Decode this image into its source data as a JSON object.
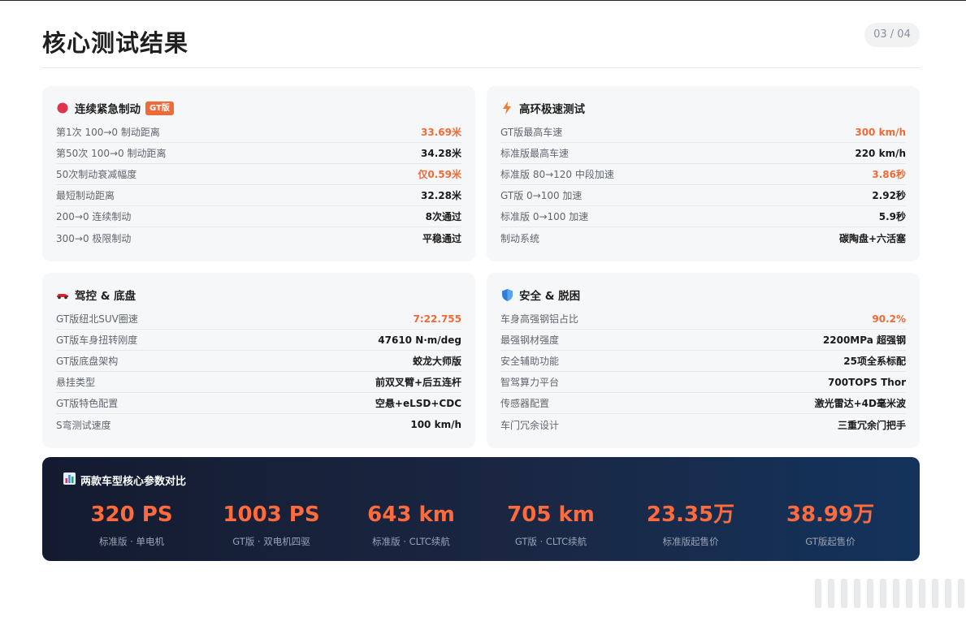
{
  "page": {
    "title": "核心测试结果",
    "counter": "03 / 04"
  },
  "cards": [
    {
      "title": "连续紧急制动",
      "tag": "GT版",
      "icon": "red-dot-icon",
      "rows": [
        {
          "label": "第1次 100→0 制动距离",
          "value": "33.69米",
          "highlight": true
        },
        {
          "label": "第50次 100→0 制动距离",
          "value": "34.28米",
          "highlight": false
        },
        {
          "label": "50次制动衰减幅度",
          "value": "仅0.59米",
          "highlight": true
        },
        {
          "label": "最短制动距离",
          "value": "32.28米",
          "highlight": false
        },
        {
          "label": "200→0 连续制动",
          "value": "8次通过",
          "highlight": false
        },
        {
          "label": "300→0 极限制动",
          "value": "平稳通过",
          "highlight": false
        }
      ]
    },
    {
      "title": "高环极速测试",
      "icon": "lightning-icon",
      "rows": [
        {
          "label": "GT版最高车速",
          "value": "300 km/h",
          "highlight": true
        },
        {
          "label": "标准版最高车速",
          "value": "220 km/h",
          "highlight": false
        },
        {
          "label": "标准版 80→120 中段加速",
          "value": "3.86秒",
          "highlight": true
        },
        {
          "label": "GT版 0→100 加速",
          "value": "2.92秒",
          "highlight": false
        },
        {
          "label": "标准版 0→100 加速",
          "value": "5.9秒",
          "highlight": false
        },
        {
          "label": "制动系统",
          "value": "碳陶盘+六活塞",
          "highlight": false
        }
      ]
    },
    {
      "title": "驾控 & 底盘",
      "icon": "race-car-icon",
      "rows": [
        {
          "label": "GT版纽北SUV圈速",
          "value": "7:22.755",
          "highlight": true
        },
        {
          "label": "GT版车身扭转刚度",
          "value": "47610 N·m/deg",
          "highlight": false
        },
        {
          "label": "GT版底盘架构",
          "value": "蛟龙大师版",
          "highlight": false
        },
        {
          "label": "悬挂类型",
          "value": "前双叉臂+后五连杆",
          "highlight": false
        },
        {
          "label": "GT版特色配置",
          "value": "空悬+eLSD+CDC",
          "highlight": false
        },
        {
          "label": "S弯测试速度",
          "value": "100 km/h",
          "highlight": false
        }
      ]
    },
    {
      "title": "安全 & 脱困",
      "icon": "shield-icon",
      "rows": [
        {
          "label": "车身高强钢铝占比",
          "value": "90.2%",
          "highlight": true
        },
        {
          "label": "最强钢材强度",
          "value": "2200MPa 超强钢",
          "highlight": false
        },
        {
          "label": "安全辅助功能",
          "value": "25项全系标配",
          "highlight": false
        },
        {
          "label": "智驾算力平台",
          "value": "700TOPS Thor",
          "highlight": false
        },
        {
          "label": "传感器配置",
          "value": "激光雷达+4D毫米波",
          "highlight": false
        },
        {
          "label": "车门冗余设计",
          "value": "三重冗余门把手",
          "highlight": false
        }
      ]
    }
  ],
  "comparison": {
    "title": "两款车型核心参数对比",
    "icon": "bar-chart-icon",
    "stats": [
      {
        "value": "320 PS",
        "label": "标准版 · 单电机"
      },
      {
        "value": "1003 PS",
        "label": "GT版 · 双电机四驱"
      },
      {
        "value": "643 km",
        "label": "标准版 · CLTC续航"
      },
      {
        "value": "705 km",
        "label": "GT版 · CLTC续航"
      },
      {
        "value": "23.35万",
        "label": "标准版起售价"
      },
      {
        "value": "38.99万",
        "label": "GT版起售价"
      }
    ]
  },
  "colors": {
    "accent": "#f06a35",
    "tag": "#ee6a3a",
    "card_bg": "#f6f7f9",
    "banner_start": "#141b30",
    "banner_end": "#13335c"
  }
}
